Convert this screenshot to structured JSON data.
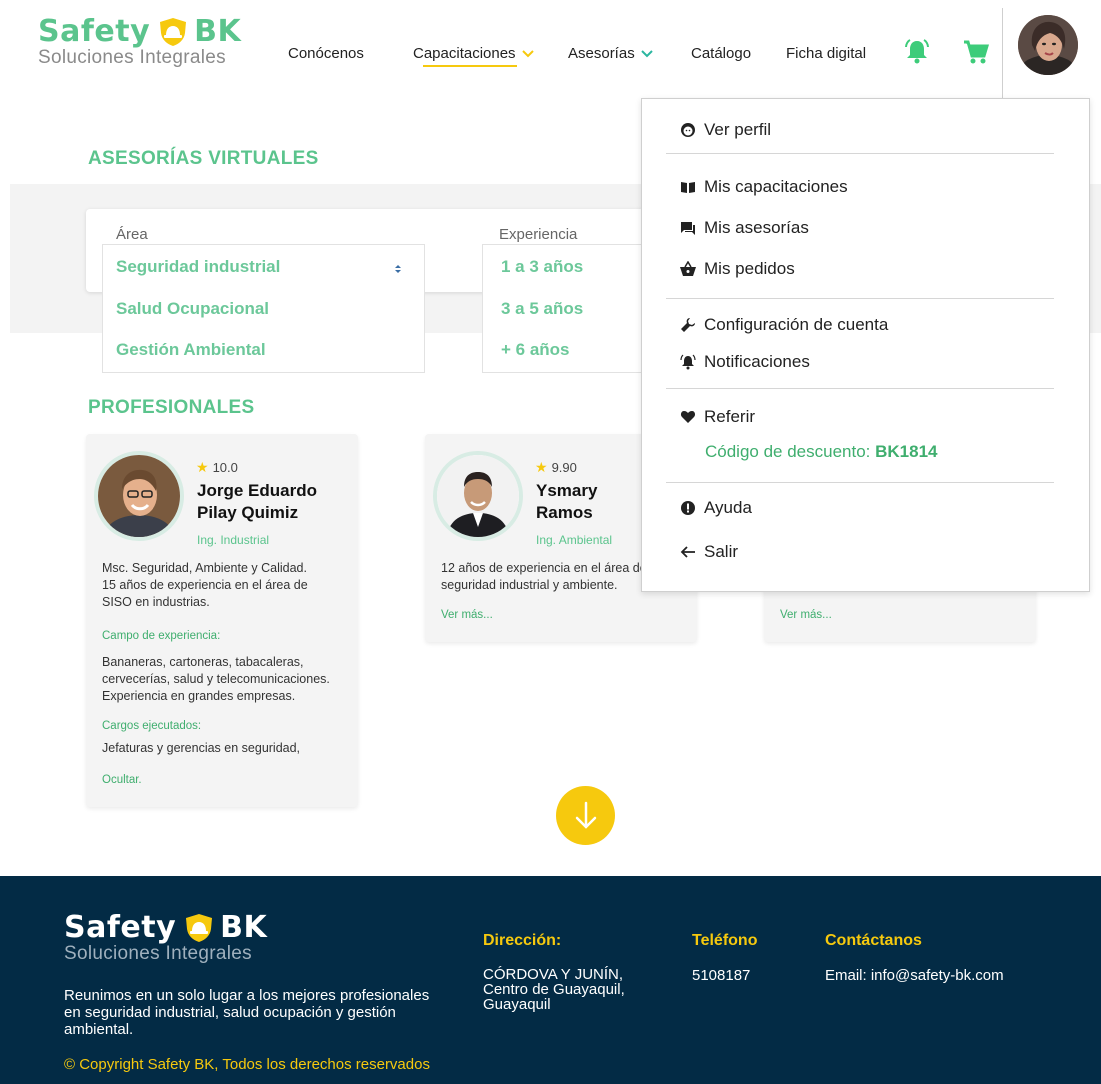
{
  "brand": {
    "name_left": "Safety",
    "name_right": "BK",
    "tagline": "Soluciones Integrales",
    "color": "#5bc48d"
  },
  "nav": {
    "items": [
      {
        "label": "Conócenos"
      },
      {
        "label": "Capacitaciones"
      },
      {
        "label": "Asesorías"
      },
      {
        "label": "Catálogo"
      },
      {
        "label": "Ficha digital"
      }
    ],
    "icons": [
      "bell-icon",
      "cart-icon"
    ],
    "accent": "#f6c90e"
  },
  "page": {
    "section_title": "ASESORÍAS VIRTUALES",
    "professionals_title": "PROFESIONALES"
  },
  "filters": {
    "area_label": "Área",
    "area_options": [
      "Seguridad industrial",
      "Salud Ocupacional",
      "Gestión Ambiental"
    ],
    "experience_label": "Experiencia",
    "experience_options": [
      "1 a 3 años",
      "3 a 5 años",
      "+ 6 años"
    ]
  },
  "professionals": [
    {
      "rating": "10.0",
      "name_line1": "Jorge Eduardo",
      "name_line2": "Pilay Quimiz",
      "role": "Ing. Industrial",
      "desc": [
        "Msc. Seguridad, Ambiente y Calidad.",
        "15 años de experiencia en el área de",
        "SISO en industrias."
      ],
      "field_label": "Campo de experiencia:",
      "field_text": [
        "Bananeras, cartoneras, tabacaleras,",
        "cervecerías, salud y telecomunicaciones.",
        "Experiencia en grandes empresas."
      ],
      "positions_label": "Cargos ejecutados:",
      "positions_text": "Jefaturas y gerencias en seguridad,",
      "toggle": "Ocultar."
    },
    {
      "rating": "9.90",
      "name_line1": "Ysmary",
      "name_line2": "Ramos",
      "role": "Ing. Ambiental",
      "desc": [
        "12 años de experiencia en el área de",
        "seguridad industrial y ambiente."
      ],
      "toggle": "Ver más..."
    },
    {
      "toggle": "Ver más..."
    }
  ],
  "user_menu": {
    "view_profile": "Ver perfil",
    "my_trainings": "Mis capacitaciones",
    "my_advisories": "Mis asesorías",
    "my_orders": "Mis pedidos",
    "account_settings": "Configuración de cuenta",
    "notifications": "Notificaciones",
    "refer": "Referir",
    "discount_label": "Código de descuento: ",
    "discount_code": "BK1814",
    "help": "Ayuda",
    "logout": "Salir"
  },
  "footer": {
    "description": [
      "Reunimos en un solo lugar a los mejores profesionales",
      "en seguridad industrial, salud ocupación y gestión",
      "ambiental."
    ],
    "copyright": "© Copyright Safety BK,  Todos los derechos reservados",
    "address_title": "Dirección:",
    "address_lines": [
      "CÓRDOVA Y JUNÍN,",
      "Centro de Guayaquil,",
      "Guayaquil"
    ],
    "phone_title": "Teléfono",
    "phone": "5108187",
    "contact_title": "Contáctanos",
    "email": "Email: info@safety-bk.com",
    "bg_color": "#032b45"
  }
}
